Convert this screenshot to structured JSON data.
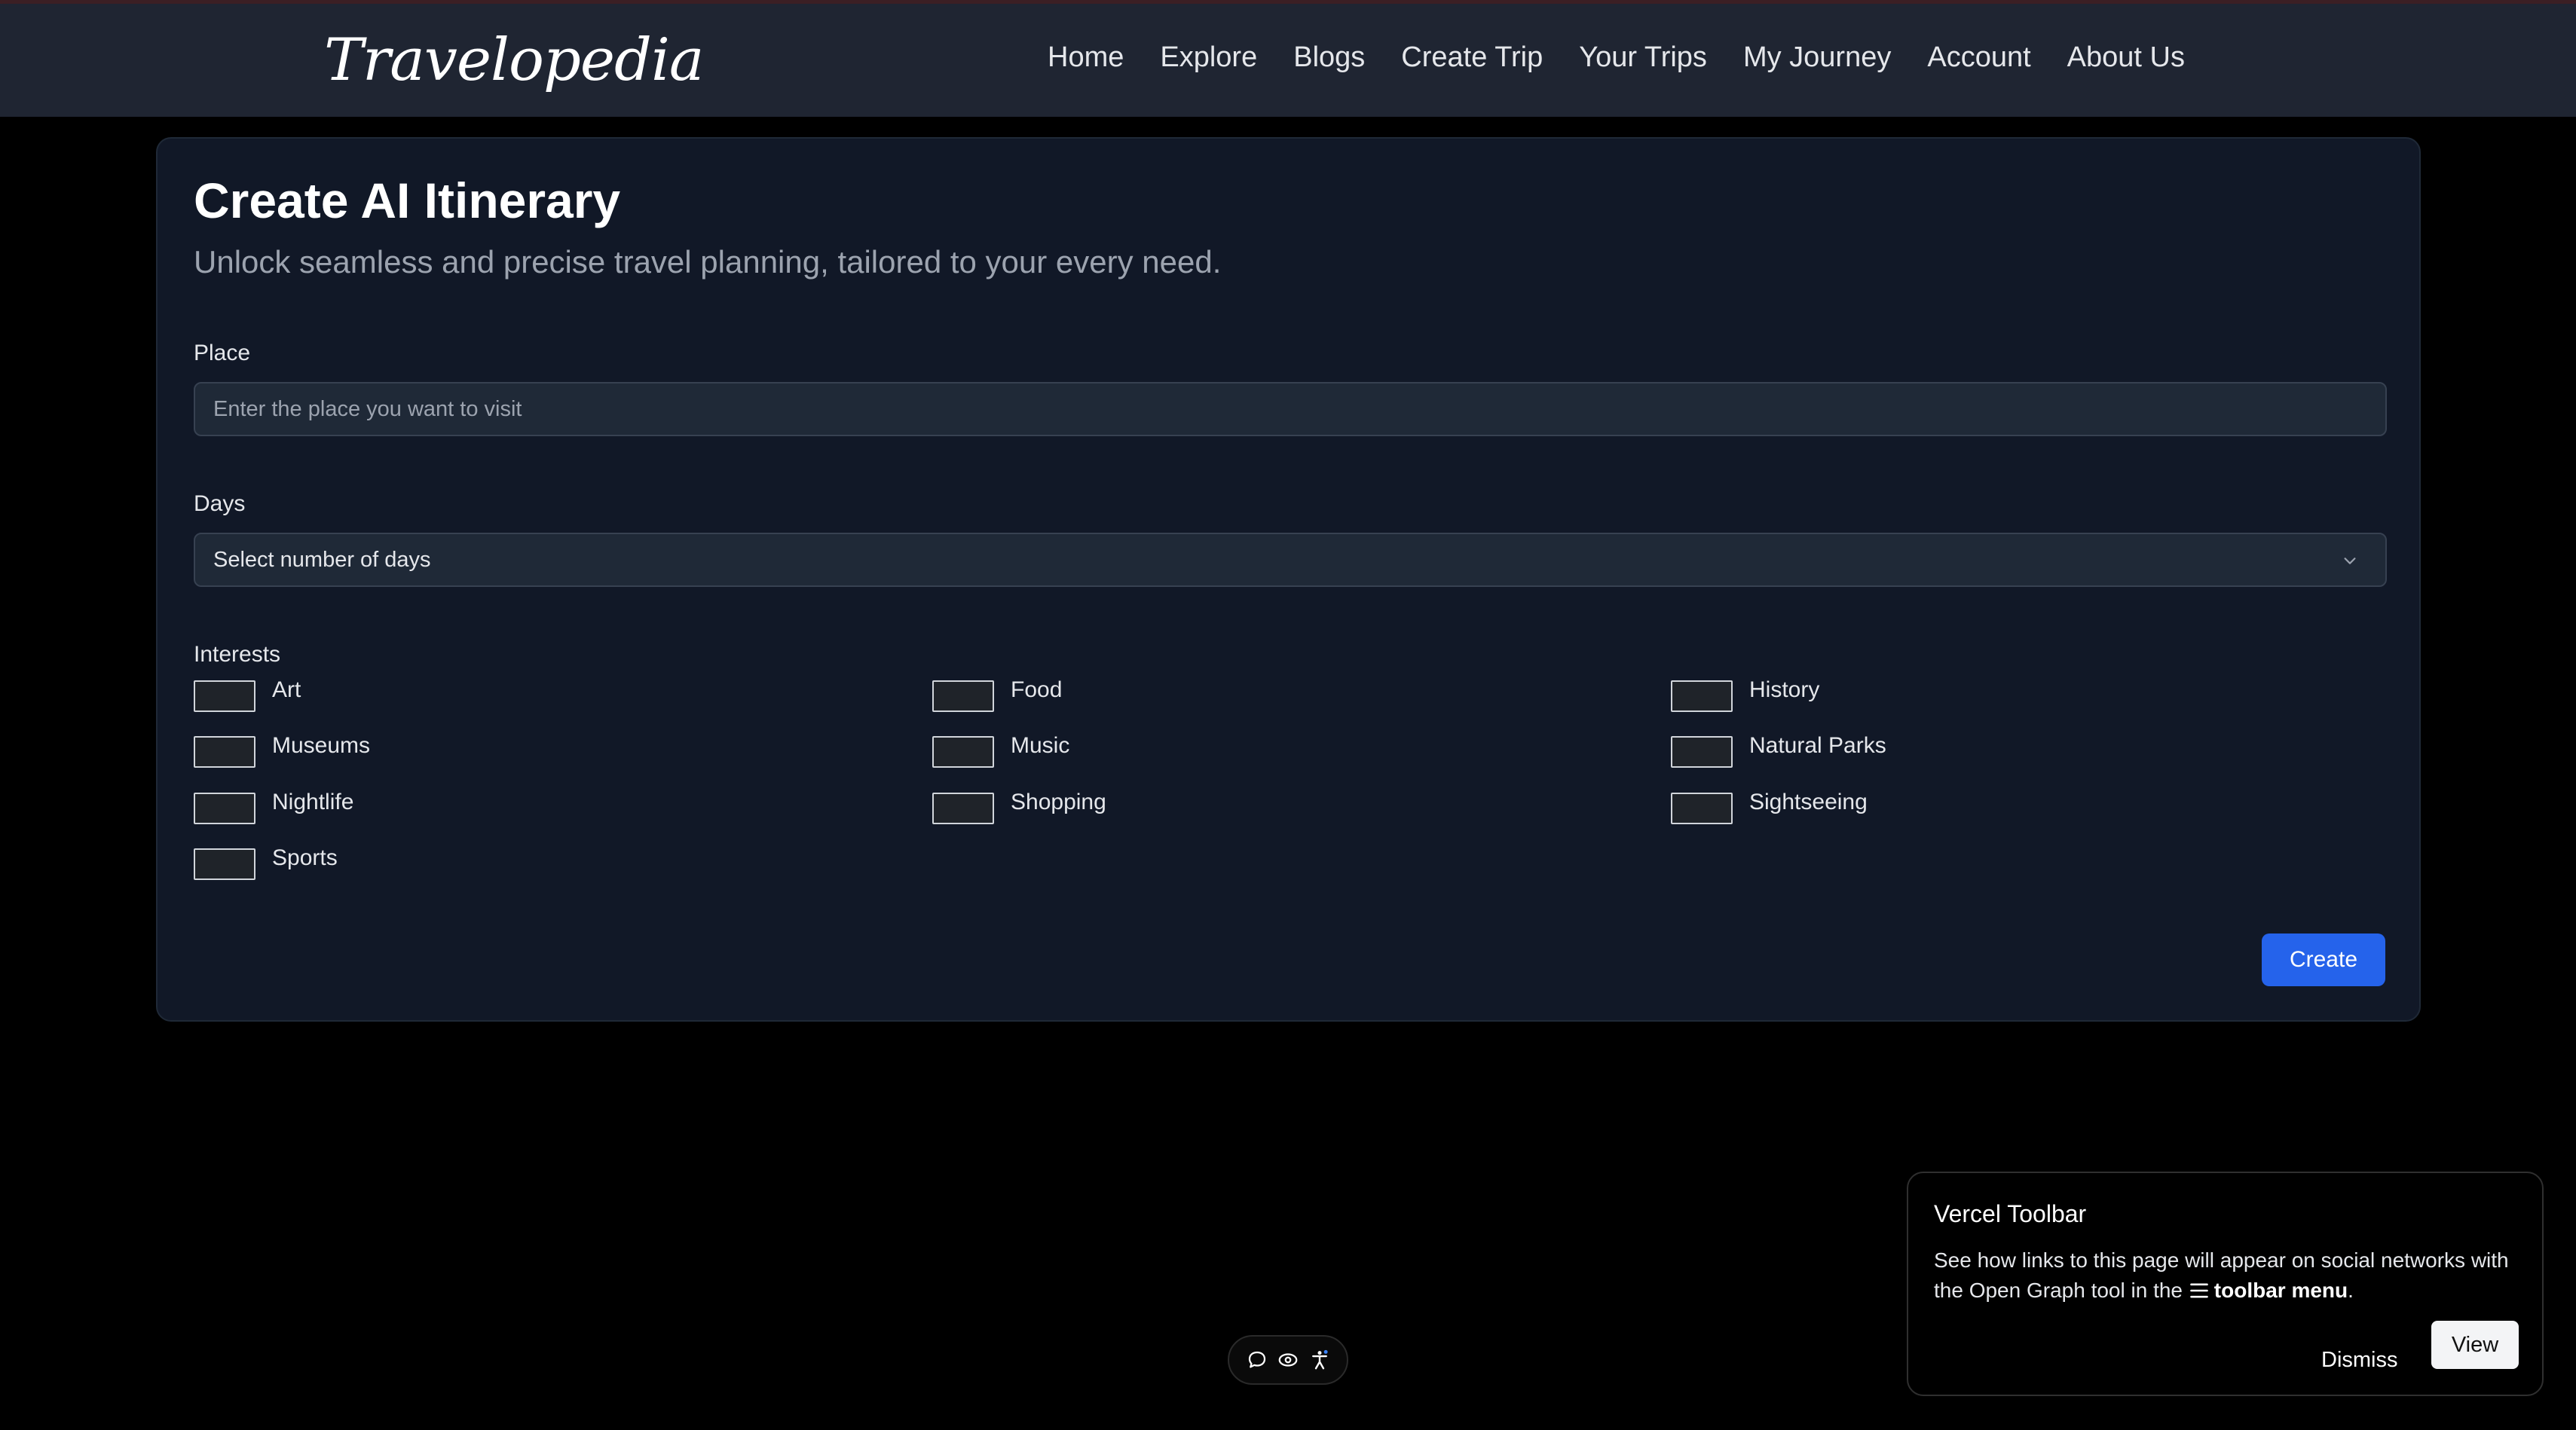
{
  "brand": {
    "name": "Travelopedia"
  },
  "nav": {
    "items": [
      {
        "label": "Home"
      },
      {
        "label": "Explore"
      },
      {
        "label": "Blogs"
      },
      {
        "label": "Create Trip"
      },
      {
        "label": "Your Trips"
      },
      {
        "label": "My Journey"
      },
      {
        "label": "Account"
      },
      {
        "label": "About Us"
      }
    ]
  },
  "form": {
    "title": "Create AI Itinerary",
    "subtitle": "Unlock seamless and precise travel planning, tailored to your every need.",
    "place": {
      "label": "Place",
      "placeholder": "Enter the place you want to visit",
      "value": ""
    },
    "days": {
      "label": "Days",
      "selected": "Select number of days"
    },
    "interests": {
      "label": "Interests",
      "options": [
        {
          "label": "Art",
          "checked": false
        },
        {
          "label": "Food",
          "checked": false
        },
        {
          "label": "History",
          "checked": false
        },
        {
          "label": "Museums",
          "checked": false
        },
        {
          "label": "Music",
          "checked": false
        },
        {
          "label": "Natural Parks",
          "checked": false
        },
        {
          "label": "Nightlife",
          "checked": false
        },
        {
          "label": "Shopping",
          "checked": false
        },
        {
          "label": "Sightseeing",
          "checked": false
        },
        {
          "label": "Sports",
          "checked": false
        }
      ]
    },
    "submit_label": "Create"
  },
  "vercel_toolbar": {
    "title": "Vercel Toolbar",
    "body_prefix": "See how links to this page will appear on social networks with the Open Graph tool in the",
    "body_bold": "toolbar menu",
    "body_suffix": ".",
    "dismiss_label": "Dismiss",
    "view_label": "View",
    "icons": [
      "comment-icon",
      "eye-icon",
      "accessibility-icon"
    ]
  },
  "colors": {
    "page_bg": "#000000",
    "navbar_bg": "#1f2532",
    "card_bg": "#111827",
    "input_bg": "#1f2937",
    "accent": "#2563eb"
  }
}
